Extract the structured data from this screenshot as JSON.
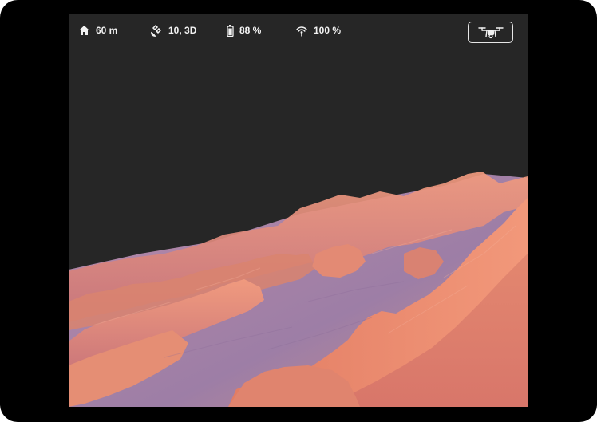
{
  "status": {
    "altitude": {
      "icon": "home-icon",
      "value": "60 m"
    },
    "gps": {
      "icon": "satellite-icon",
      "value": "10, 3D"
    },
    "battery": {
      "icon": "battery-icon",
      "value": "88 %",
      "level": 0.88
    },
    "signal": {
      "icon": "signal-icon",
      "value": "100 %"
    }
  },
  "drone_button": {
    "icon": "drone-icon"
  },
  "colors": {
    "sky": "#262626",
    "text": "#f2f2f2",
    "terrain_light": "#e8866d",
    "terrain_shadow": "#a77fa8"
  }
}
